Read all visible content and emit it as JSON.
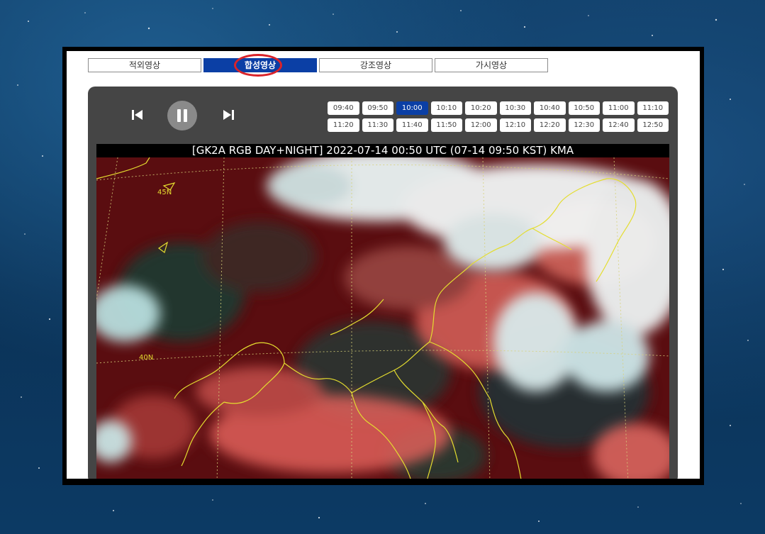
{
  "tabs": [
    {
      "label": "적외영상",
      "active": false
    },
    {
      "label": "합성영상",
      "active": true
    },
    {
      "label": "강조영상",
      "active": false
    },
    {
      "label": "가시영상",
      "active": false
    }
  ],
  "player": {
    "controls": [
      "skip-previous-icon",
      "pause-icon",
      "skip-next-icon"
    ],
    "times": [
      "09:40",
      "09:50",
      "10:00",
      "10:10",
      "10:20",
      "10:30",
      "10:40",
      "10:50",
      "11:00",
      "11:10",
      "11:20",
      "11:30",
      "11:40",
      "11:50",
      "12:00",
      "12:10",
      "12:20",
      "12:30",
      "12:40",
      "12:50"
    ],
    "selected_time": "10:00"
  },
  "image": {
    "title": "[GK2A RGB DAY+NIGHT] 2022-07-14 00:50 UTC (07-14 09:50 KST) KMA",
    "lat_labels": [
      "45N",
      "40N"
    ]
  },
  "colors": {
    "accent": "#0b3fa5",
    "highlight_ring": "#d9232a",
    "player_bg": "#454545"
  }
}
